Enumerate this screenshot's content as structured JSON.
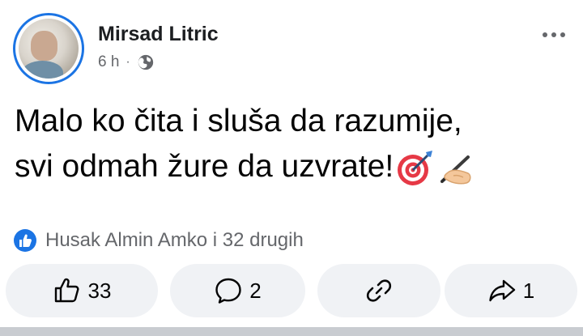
{
  "author": {
    "name": "Mirsad Litric"
  },
  "post_meta": {
    "time": "6 h",
    "separator": "·",
    "audience_icon": "globe-icon"
  },
  "post": {
    "line1": "Malo ko čita i sluša da razumije,",
    "line2": "svi odmah žure da uzvrate!",
    "emojis": [
      "direct-hit-emoji",
      "writing-hand-emoji"
    ]
  },
  "reactions": {
    "summary": "Husak Almin Amko i 32 drugih",
    "icon": "like-badge-icon"
  },
  "actions": {
    "like": {
      "icon": "thumbs-up-icon",
      "count": "33"
    },
    "comment": {
      "icon": "comment-icon",
      "count": "2"
    },
    "link": {
      "icon": "link-icon"
    },
    "share": {
      "icon": "share-icon",
      "count": "1"
    }
  },
  "colors": {
    "accent": "#1b74e4",
    "button_bg": "#f0f2f5",
    "secondary_text": "#65676b"
  }
}
